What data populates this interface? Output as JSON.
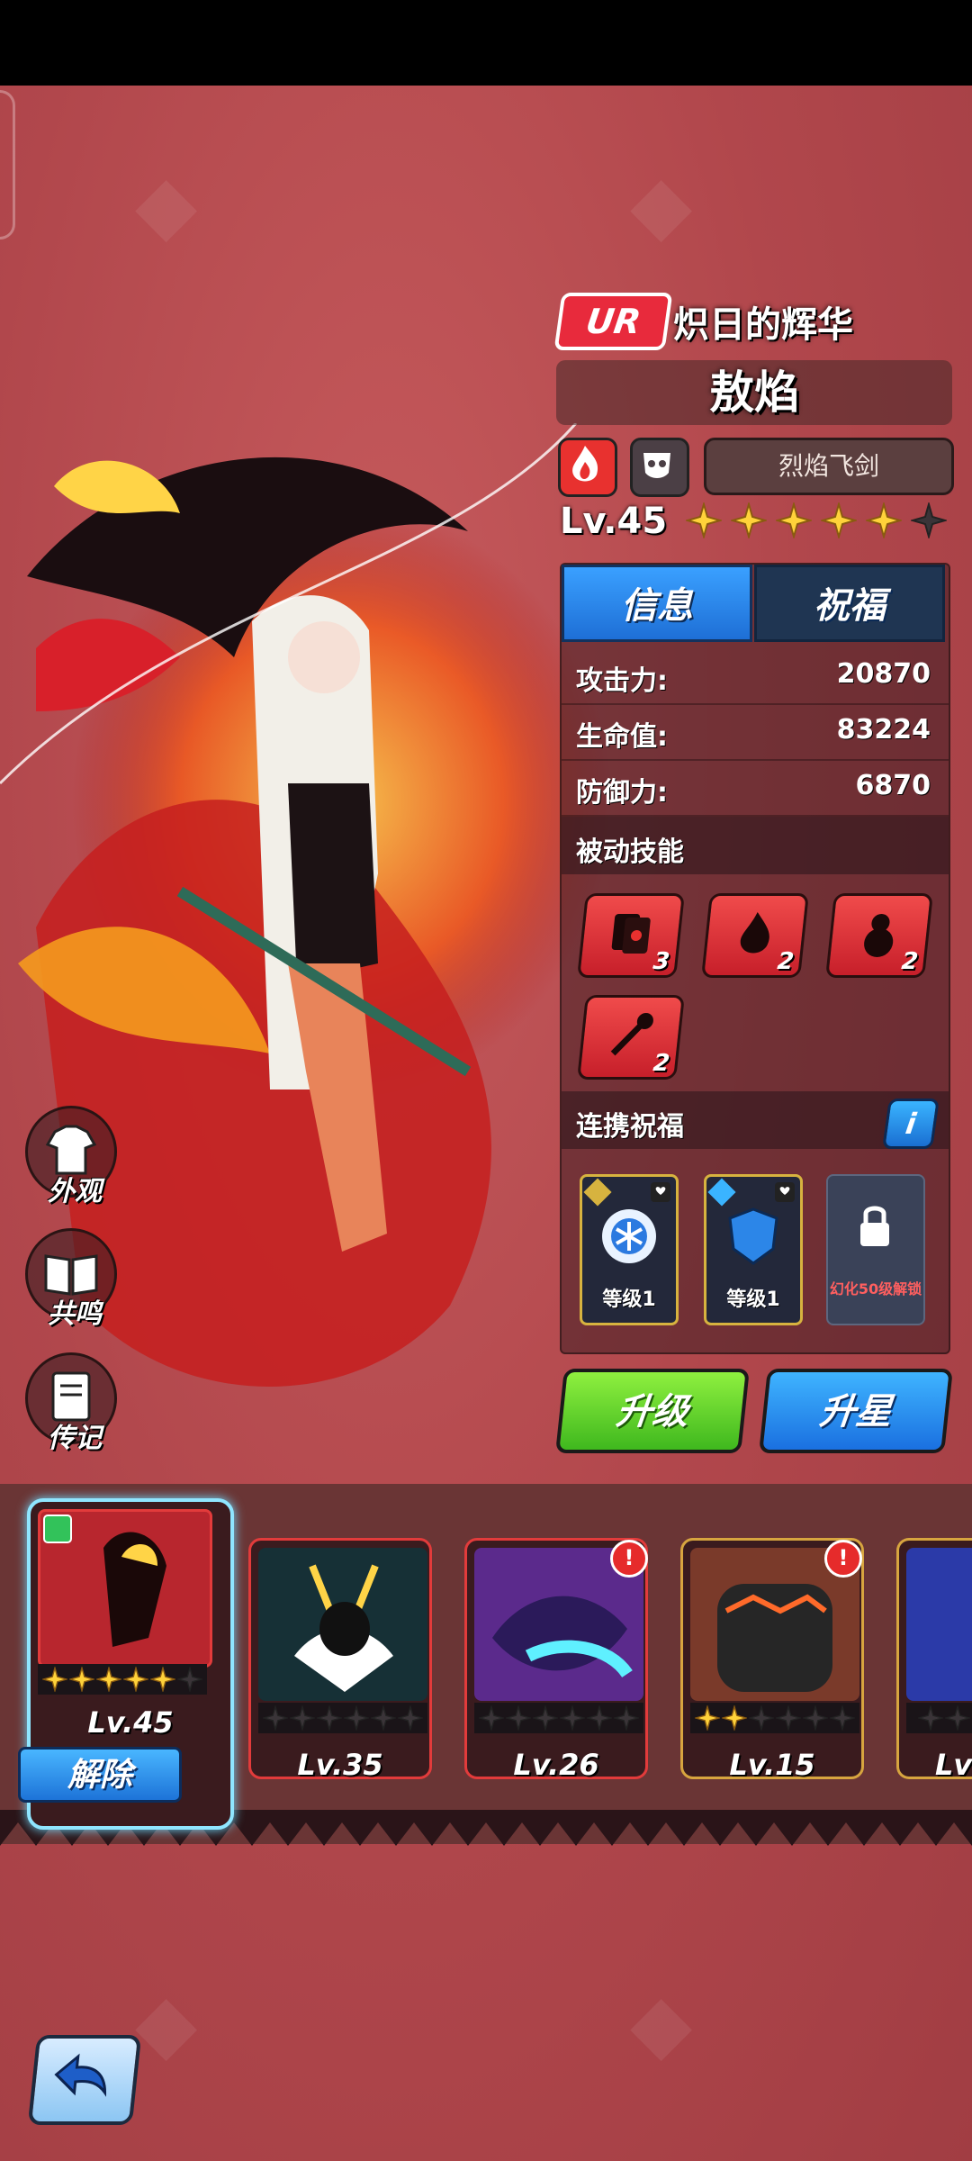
{
  "hero": {
    "rarity": "UR",
    "epithet": "炽日的辉华",
    "name": "敖焰",
    "weapon": "烈焰飞剑",
    "level": "Lv.45",
    "stars_filled": 5,
    "stars_total": 6
  },
  "tabs": {
    "info": "信息",
    "blessing": "祝福"
  },
  "stats": [
    {
      "label": "攻击力:",
      "value": "20870"
    },
    {
      "label": "生命值:",
      "value": "83224"
    },
    {
      "label": "防御力:",
      "value": "6870"
    }
  ],
  "passive": {
    "title": "被动技能",
    "skills": [
      {
        "icon": "card-skill-icon",
        "count": "3"
      },
      {
        "icon": "fire-skill-icon",
        "count": "2"
      },
      {
        "icon": "gourd-skill-icon",
        "count": "2"
      },
      {
        "icon": "staff-skill-icon",
        "count": "2"
      }
    ]
  },
  "link_blessing": {
    "title": "连携祝福",
    "info_btn": "i",
    "cards": [
      {
        "label": "等级1",
        "icon": "snowflake-orb-icon"
      },
      {
        "label": "等级1",
        "icon": "blue-shield-icon"
      },
      {
        "label": "幻化50级解锁",
        "icon": "lock-icon"
      }
    ]
  },
  "actions": {
    "upgrade": "升级",
    "star_up": "升星"
  },
  "side_buttons": [
    {
      "label": "外观",
      "icon": "shirt-icon"
    },
    {
      "label": "共鸣",
      "icon": "book-icon"
    },
    {
      "label": "传记",
      "icon": "journal-icon"
    }
  ],
  "roster": [
    {
      "level": "Lv.45",
      "stars": 5,
      "selected": true,
      "action": "解除",
      "alert": false
    },
    {
      "level": "Lv.35",
      "stars": 0,
      "selected": false,
      "alert": false
    },
    {
      "level": "Lv.26",
      "stars": 0,
      "selected": false,
      "alert": true
    },
    {
      "level": "Lv.15",
      "stars": 2,
      "selected": false,
      "alert": true
    },
    {
      "level": "Lv",
      "stars": 0,
      "selected": false,
      "alert": false
    }
  ],
  "alert_glyph": "!",
  "colors": {
    "fire_red": "#e8312f",
    "blue_tab": "#1e6fd6",
    "green_btn": "#3fb81e",
    "gold_star": "#ffd23a"
  }
}
